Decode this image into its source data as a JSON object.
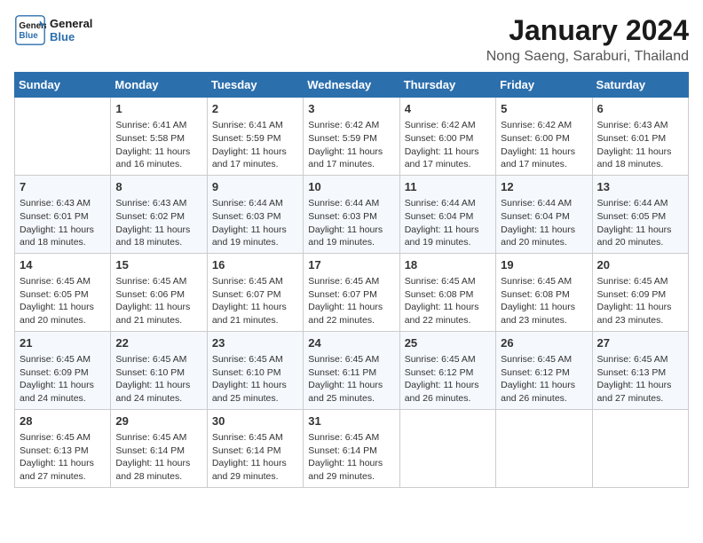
{
  "logo": {
    "line1": "General",
    "line2": "Blue"
  },
  "title": "January 2024",
  "location": "Nong Saeng, Saraburi, Thailand",
  "days_header": [
    "Sunday",
    "Monday",
    "Tuesday",
    "Wednesday",
    "Thursday",
    "Friday",
    "Saturday"
  ],
  "weeks": [
    [
      {
        "num": "",
        "content": ""
      },
      {
        "num": "1",
        "content": "Sunrise: 6:41 AM\nSunset: 5:58 PM\nDaylight: 11 hours\nand 16 minutes."
      },
      {
        "num": "2",
        "content": "Sunrise: 6:41 AM\nSunset: 5:59 PM\nDaylight: 11 hours\nand 17 minutes."
      },
      {
        "num": "3",
        "content": "Sunrise: 6:42 AM\nSunset: 5:59 PM\nDaylight: 11 hours\nand 17 minutes."
      },
      {
        "num": "4",
        "content": "Sunrise: 6:42 AM\nSunset: 6:00 PM\nDaylight: 11 hours\nand 17 minutes."
      },
      {
        "num": "5",
        "content": "Sunrise: 6:42 AM\nSunset: 6:00 PM\nDaylight: 11 hours\nand 17 minutes."
      },
      {
        "num": "6",
        "content": "Sunrise: 6:43 AM\nSunset: 6:01 PM\nDaylight: 11 hours\nand 18 minutes."
      }
    ],
    [
      {
        "num": "7",
        "content": "Sunrise: 6:43 AM\nSunset: 6:01 PM\nDaylight: 11 hours\nand 18 minutes."
      },
      {
        "num": "8",
        "content": "Sunrise: 6:43 AM\nSunset: 6:02 PM\nDaylight: 11 hours\nand 18 minutes."
      },
      {
        "num": "9",
        "content": "Sunrise: 6:44 AM\nSunset: 6:03 PM\nDaylight: 11 hours\nand 19 minutes."
      },
      {
        "num": "10",
        "content": "Sunrise: 6:44 AM\nSunset: 6:03 PM\nDaylight: 11 hours\nand 19 minutes."
      },
      {
        "num": "11",
        "content": "Sunrise: 6:44 AM\nSunset: 6:04 PM\nDaylight: 11 hours\nand 19 minutes."
      },
      {
        "num": "12",
        "content": "Sunrise: 6:44 AM\nSunset: 6:04 PM\nDaylight: 11 hours\nand 20 minutes."
      },
      {
        "num": "13",
        "content": "Sunrise: 6:44 AM\nSunset: 6:05 PM\nDaylight: 11 hours\nand 20 minutes."
      }
    ],
    [
      {
        "num": "14",
        "content": "Sunrise: 6:45 AM\nSunset: 6:05 PM\nDaylight: 11 hours\nand 20 minutes."
      },
      {
        "num": "15",
        "content": "Sunrise: 6:45 AM\nSunset: 6:06 PM\nDaylight: 11 hours\nand 21 minutes."
      },
      {
        "num": "16",
        "content": "Sunrise: 6:45 AM\nSunset: 6:07 PM\nDaylight: 11 hours\nand 21 minutes."
      },
      {
        "num": "17",
        "content": "Sunrise: 6:45 AM\nSunset: 6:07 PM\nDaylight: 11 hours\nand 22 minutes."
      },
      {
        "num": "18",
        "content": "Sunrise: 6:45 AM\nSunset: 6:08 PM\nDaylight: 11 hours\nand 22 minutes."
      },
      {
        "num": "19",
        "content": "Sunrise: 6:45 AM\nSunset: 6:08 PM\nDaylight: 11 hours\nand 23 minutes."
      },
      {
        "num": "20",
        "content": "Sunrise: 6:45 AM\nSunset: 6:09 PM\nDaylight: 11 hours\nand 23 minutes."
      }
    ],
    [
      {
        "num": "21",
        "content": "Sunrise: 6:45 AM\nSunset: 6:09 PM\nDaylight: 11 hours\nand 24 minutes."
      },
      {
        "num": "22",
        "content": "Sunrise: 6:45 AM\nSunset: 6:10 PM\nDaylight: 11 hours\nand 24 minutes."
      },
      {
        "num": "23",
        "content": "Sunrise: 6:45 AM\nSunset: 6:10 PM\nDaylight: 11 hours\nand 25 minutes."
      },
      {
        "num": "24",
        "content": "Sunrise: 6:45 AM\nSunset: 6:11 PM\nDaylight: 11 hours\nand 25 minutes."
      },
      {
        "num": "25",
        "content": "Sunrise: 6:45 AM\nSunset: 6:12 PM\nDaylight: 11 hours\nand 26 minutes."
      },
      {
        "num": "26",
        "content": "Sunrise: 6:45 AM\nSunset: 6:12 PM\nDaylight: 11 hours\nand 26 minutes."
      },
      {
        "num": "27",
        "content": "Sunrise: 6:45 AM\nSunset: 6:13 PM\nDaylight: 11 hours\nand 27 minutes."
      }
    ],
    [
      {
        "num": "28",
        "content": "Sunrise: 6:45 AM\nSunset: 6:13 PM\nDaylight: 11 hours\nand 27 minutes."
      },
      {
        "num": "29",
        "content": "Sunrise: 6:45 AM\nSunset: 6:14 PM\nDaylight: 11 hours\nand 28 minutes."
      },
      {
        "num": "30",
        "content": "Sunrise: 6:45 AM\nSunset: 6:14 PM\nDaylight: 11 hours\nand 29 minutes."
      },
      {
        "num": "31",
        "content": "Sunrise: 6:45 AM\nSunset: 6:14 PM\nDaylight: 11 hours\nand 29 minutes."
      },
      {
        "num": "",
        "content": ""
      },
      {
        "num": "",
        "content": ""
      },
      {
        "num": "",
        "content": ""
      }
    ]
  ]
}
